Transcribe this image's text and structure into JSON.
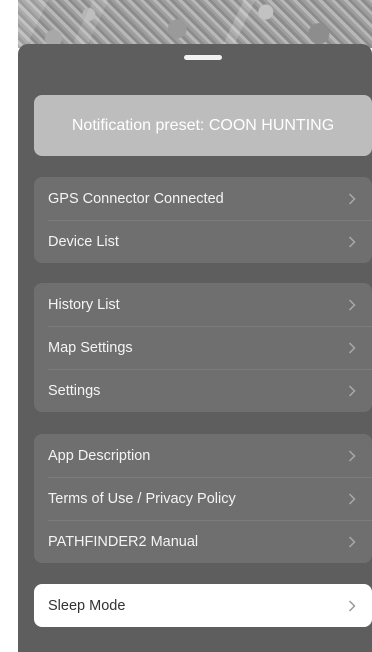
{
  "preset_banner": {
    "label": "Notification preset: COON HUNTING"
  },
  "groups": [
    {
      "items": [
        {
          "label": "GPS Connector Connected"
        },
        {
          "label": "Device List"
        }
      ]
    },
    {
      "items": [
        {
          "label": "History List"
        },
        {
          "label": "Map Settings"
        },
        {
          "label": "Settings"
        }
      ]
    },
    {
      "items": [
        {
          "label": "App Description"
        },
        {
          "label": "Terms of Use / Privacy Policy"
        },
        {
          "label": "PATHFINDER2 Manual"
        }
      ]
    }
  ],
  "sleep_mode": {
    "label": "Sleep Mode"
  },
  "colors": {
    "sheet_background": "#5e5e5e",
    "group_background": "#6f6f6f",
    "banner_background": "#bdbdbd",
    "chevron": "#a8a8a8"
  },
  "icons": {
    "row_chevron": "chevron-right-icon"
  }
}
